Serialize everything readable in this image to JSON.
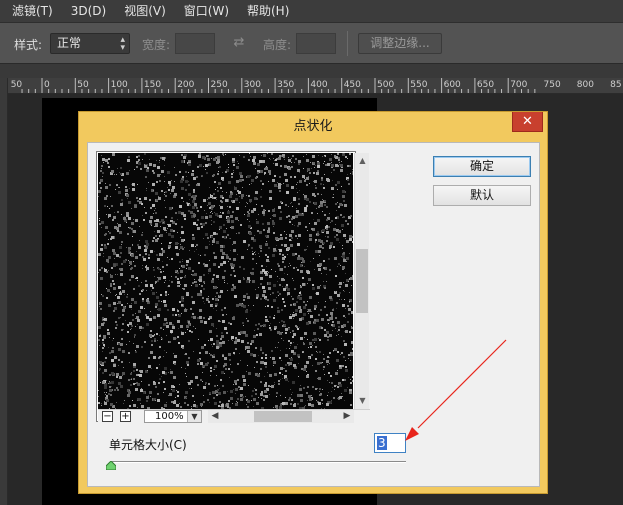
{
  "menubar": {
    "items": [
      {
        "label": "滤镜(T)"
      },
      {
        "label": "3D(D)"
      },
      {
        "label": "视图(V)"
      },
      {
        "label": "窗口(W)"
      },
      {
        "label": "帮助(H)"
      }
    ]
  },
  "options": {
    "style_label": "样式:",
    "style_value": "正常",
    "width_label": "宽度:",
    "height_label": "高度:",
    "refine_edge_label": "调整边缘..."
  },
  "ruler": {
    "ticks": [
      "50",
      "0",
      "50",
      "100",
      "150",
      "200",
      "250",
      "300",
      "350",
      "400",
      "450",
      "500",
      "550",
      "600",
      "650",
      "700",
      "750",
      "800",
      "85"
    ]
  },
  "dialog": {
    "title": "点状化",
    "close_glyph": "✕",
    "ok_label": "确定",
    "default_label": "默认",
    "zoom_minus": "−",
    "zoom_plus": "+",
    "zoom_value": "100%",
    "cell_size_label": "单元格大小(C)",
    "cell_size_value": "3"
  },
  "colors": {
    "accent_arrow": "#e8251c",
    "title_bar": "#f2c95e",
    "close_button": "#c8402e"
  }
}
